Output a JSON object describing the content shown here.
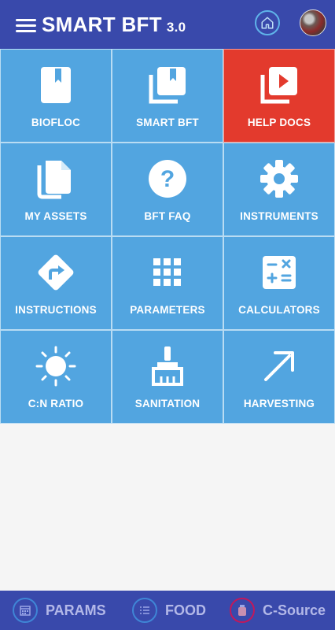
{
  "header": {
    "title": "SMART BFT",
    "version": "3.0",
    "menu_icon": "hamburger-menu-icon",
    "home_icon": "home-icon",
    "avatar": "user-avatar"
  },
  "tiles": [
    {
      "label": "BIOFLOC",
      "icon": "book-icon"
    },
    {
      "label": "SMART BFT",
      "icon": "library-books-icon"
    },
    {
      "label": "HELP DOCS",
      "icon": "video-library-icon",
      "active": true
    },
    {
      "label": "MY ASSETS",
      "icon": "documents-icon"
    },
    {
      "label": "BFT FAQ",
      "icon": "help-circle-icon"
    },
    {
      "label": "INSTRUMENTS",
      "icon": "gear-icon"
    },
    {
      "label": "INSTRUCTIONS",
      "icon": "directions-icon"
    },
    {
      "label": "PARAMETERS",
      "icon": "grid-icon"
    },
    {
      "label": "CALCULATORS",
      "icon": "calculator-icon"
    },
    {
      "label": "C:N RATIO",
      "icon": "sun-icon"
    },
    {
      "label": "SANITATION",
      "icon": "brush-icon"
    },
    {
      "label": "HARVESTING",
      "icon": "arrow-up-right-icon"
    }
  ],
  "bottom_nav": [
    {
      "label": "PARAMS",
      "icon": "calendar-icon"
    },
    {
      "label": "FOOD",
      "icon": "list-icon"
    },
    {
      "label": "C-Source",
      "icon": "jar-icon"
    }
  ],
  "colors": {
    "primary": "#3949ab",
    "tile": "#52a5e0",
    "tile_active": "#e33a2d",
    "background": "#f5f5f5"
  }
}
